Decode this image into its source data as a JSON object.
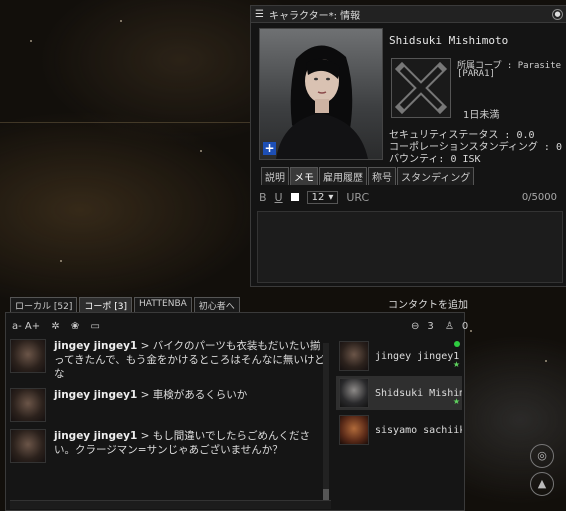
{
  "character_window": {
    "title": "キャラクター*: 情報",
    "name": "Shidsuki Mishimoto",
    "corp_label": "所属コープ : Parasite",
    "corp_ticker": "[PARA1]",
    "age": "1日未満",
    "security_status": "セキュリティステータス : 0.0",
    "corp_standing": "コーポレーションスタンディング : 0",
    "bounty": "バウンティ: 0 ISK",
    "tabs": [
      "説明",
      "メモ",
      "雇用履歴",
      "称号",
      "スタンディング"
    ],
    "active_tab": "メモ",
    "toolbar": {
      "bold": "B",
      "underline": "U",
      "font_size": "12",
      "url": "URC",
      "char_count": "0/5000"
    }
  },
  "chat_window": {
    "tabs": [
      "ローカル [52]",
      "コーポ [3]",
      "HATTENBA",
      "初心者へ"
    ],
    "active_tab": "コーポ [3]",
    "tools": {
      "font_size": "a- A+"
    },
    "member_tools": {
      "member_count": "3",
      "pilot_count": "0"
    },
    "messages": [
      {
        "sender": "jingey jingey1",
        "text": " > バイクのパーツも衣装もだいたい揃ってきたんで、もう金をかけるところはそんなに無いけどな"
      },
      {
        "sender": "jingey jingey1",
        "text": " > 車検があるくらいか"
      },
      {
        "sender": "jingey jingey1",
        "text": " > もし間違いでしたらごめんください。クラージマン=サンじゃあございませんか？"
      }
    ],
    "members": [
      {
        "name": "jingey jingey1",
        "online": true
      },
      {
        "name": "Shidsuki Mishimoto",
        "online": false
      },
      {
        "name": "sisyamo sachiiko",
        "online": false
      }
    ]
  },
  "add_contact_label": "コンタクトを追加"
}
